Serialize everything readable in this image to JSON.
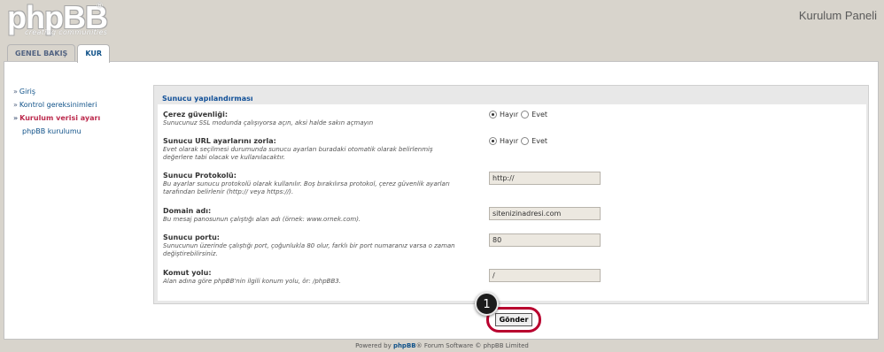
{
  "header": {
    "logo_text": "phpBB",
    "logo_sup": "®",
    "logo_tagline": "creating communities",
    "panel_title": "Kurulum Paneli"
  },
  "tabs": [
    {
      "label": "GENEL BAKIŞ",
      "active": false
    },
    {
      "label": "KUR",
      "active": true
    }
  ],
  "sidebar": {
    "items": [
      {
        "mark": "»",
        "label": "Giriş",
        "active": false
      },
      {
        "mark": "»",
        "label": "Kontrol gereksinimleri",
        "active": false
      },
      {
        "mark": "»",
        "label": "Kurulum verisi ayarı",
        "active": true
      },
      {
        "mark": "",
        "label": "phpBB kurulumu",
        "active": false
      }
    ]
  },
  "form": {
    "legend": "Sunucu yapılandırması",
    "rows": [
      {
        "label": "Çerez güvenliği:",
        "desc": "Sunucunuz SSL modunda çalışıyorsa açın, aksi halde sakın açmayın",
        "type": "radio",
        "options": [
          "Hayır",
          "Evet"
        ],
        "selected": "Hayır"
      },
      {
        "label": "Sunucu URL ayarlarını zorla:",
        "desc": "Evet olarak seçilmesi durumunda sunucu ayarları buradaki otomatik olarak belirlenmiş değerlere tabi olacak ve kullanılacaktır.",
        "type": "radio",
        "options": [
          "Hayır",
          "Evet"
        ],
        "selected": "Hayır"
      },
      {
        "label": "Sunucu Protokolü:",
        "desc": "Bu ayarlar sunucu protokolü olarak kullanılır. Boş bırakılırsa protokol, çerez güvenlik ayarları tarafından belirlenir (http:// veya https://).",
        "type": "text",
        "value": "http://"
      },
      {
        "label": "Domain adı:",
        "desc": "Bu mesaj panosunun çalıştığı alan adı (örnek: www.ornek.com).",
        "type": "text",
        "value": "sitenizinadresi.com"
      },
      {
        "label": "Sunucu portu:",
        "desc": "Sunucunun üzerinde çalıştığı port, çoğunlukla 80 olur, farklı bir port numaranız varsa o zaman değiştirebilirsiniz.",
        "type": "text",
        "value": "80"
      },
      {
        "label": "Komut yolu:",
        "desc": "Alan adına göre phpBB'nin ilgili konum yolu, ör: /phpBB3.",
        "type": "text",
        "value": "/"
      }
    ],
    "submit_label": "Gönder"
  },
  "annotation": {
    "step": "1",
    "highlight_color": "#b8002e"
  },
  "footer": {
    "prefix": "Powered by ",
    "brand": "phpBB",
    "suffix": "® Forum Software © phpBB Limited"
  }
}
